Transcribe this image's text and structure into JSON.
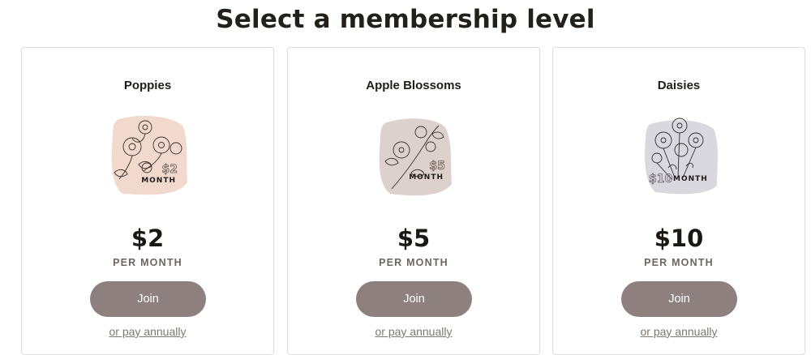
{
  "page": {
    "title": "Select a membership level"
  },
  "colors": {
    "button_bg": "#8f8080",
    "poppies_wash": "#efd2c5",
    "apple_blossoms_wash": "#d9ccc8",
    "daisies_wash": "#d8d6dd"
  },
  "tiers": [
    {
      "name": "Poppies",
      "badge_amount": "$2",
      "badge_unit": "MONTH",
      "price": "$2",
      "period": "PER MONTH",
      "join_label": "Join",
      "annual_link": "or pay annually",
      "icon": "poppy-flowers-illustration"
    },
    {
      "name": "Apple Blossoms",
      "badge_amount": "$5",
      "badge_unit": "MONTH",
      "price": "$5",
      "period": "PER MONTH",
      "join_label": "Join",
      "annual_link": "or pay annually",
      "icon": "apple-blossom-illustration"
    },
    {
      "name": "Daisies",
      "badge_amount": "$10",
      "badge_unit": "MONTH",
      "price": "$10",
      "period": "PER MONTH",
      "join_label": "Join",
      "annual_link": "or pay annually",
      "icon": "daisies-illustration"
    }
  ]
}
